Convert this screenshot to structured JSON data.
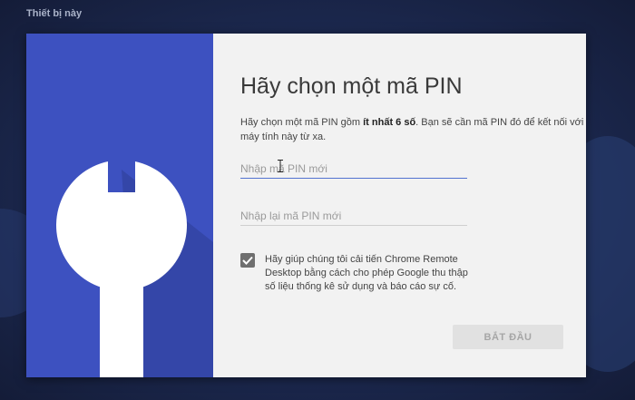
{
  "header": {
    "section_label": "Thiết bị này"
  },
  "dialog": {
    "illustration": "wrench-icon",
    "title": "Hãy chọn một mã PIN",
    "description": {
      "part1": "Hãy chọn một mã PIN gồm ",
      "emphasis": "ít nhất 6 số",
      "part2": ". Bạn sẽ cần mã PIN đó để kết nối với máy tính này từ xa."
    },
    "pin_input": {
      "placeholder": "Nhập mã PIN mới",
      "value": ""
    },
    "pin_confirm_input": {
      "placeholder": "Nhập lại mã PIN mới",
      "value": ""
    },
    "consent": {
      "checked": true,
      "label": "Hãy giúp chúng tôi cải tiến Chrome Remote Desktop bằng cách cho phép Google thu thập số liệu thống kê sử dụng và báo cáo sự cố."
    },
    "start_button_label": "BẮT ĐẦU"
  },
  "colors": {
    "illustration_bg": "#3d51c0",
    "dialog_bg": "#f2f2f2",
    "input_focus": "#5273d0",
    "page_bg": "#1c2950"
  }
}
